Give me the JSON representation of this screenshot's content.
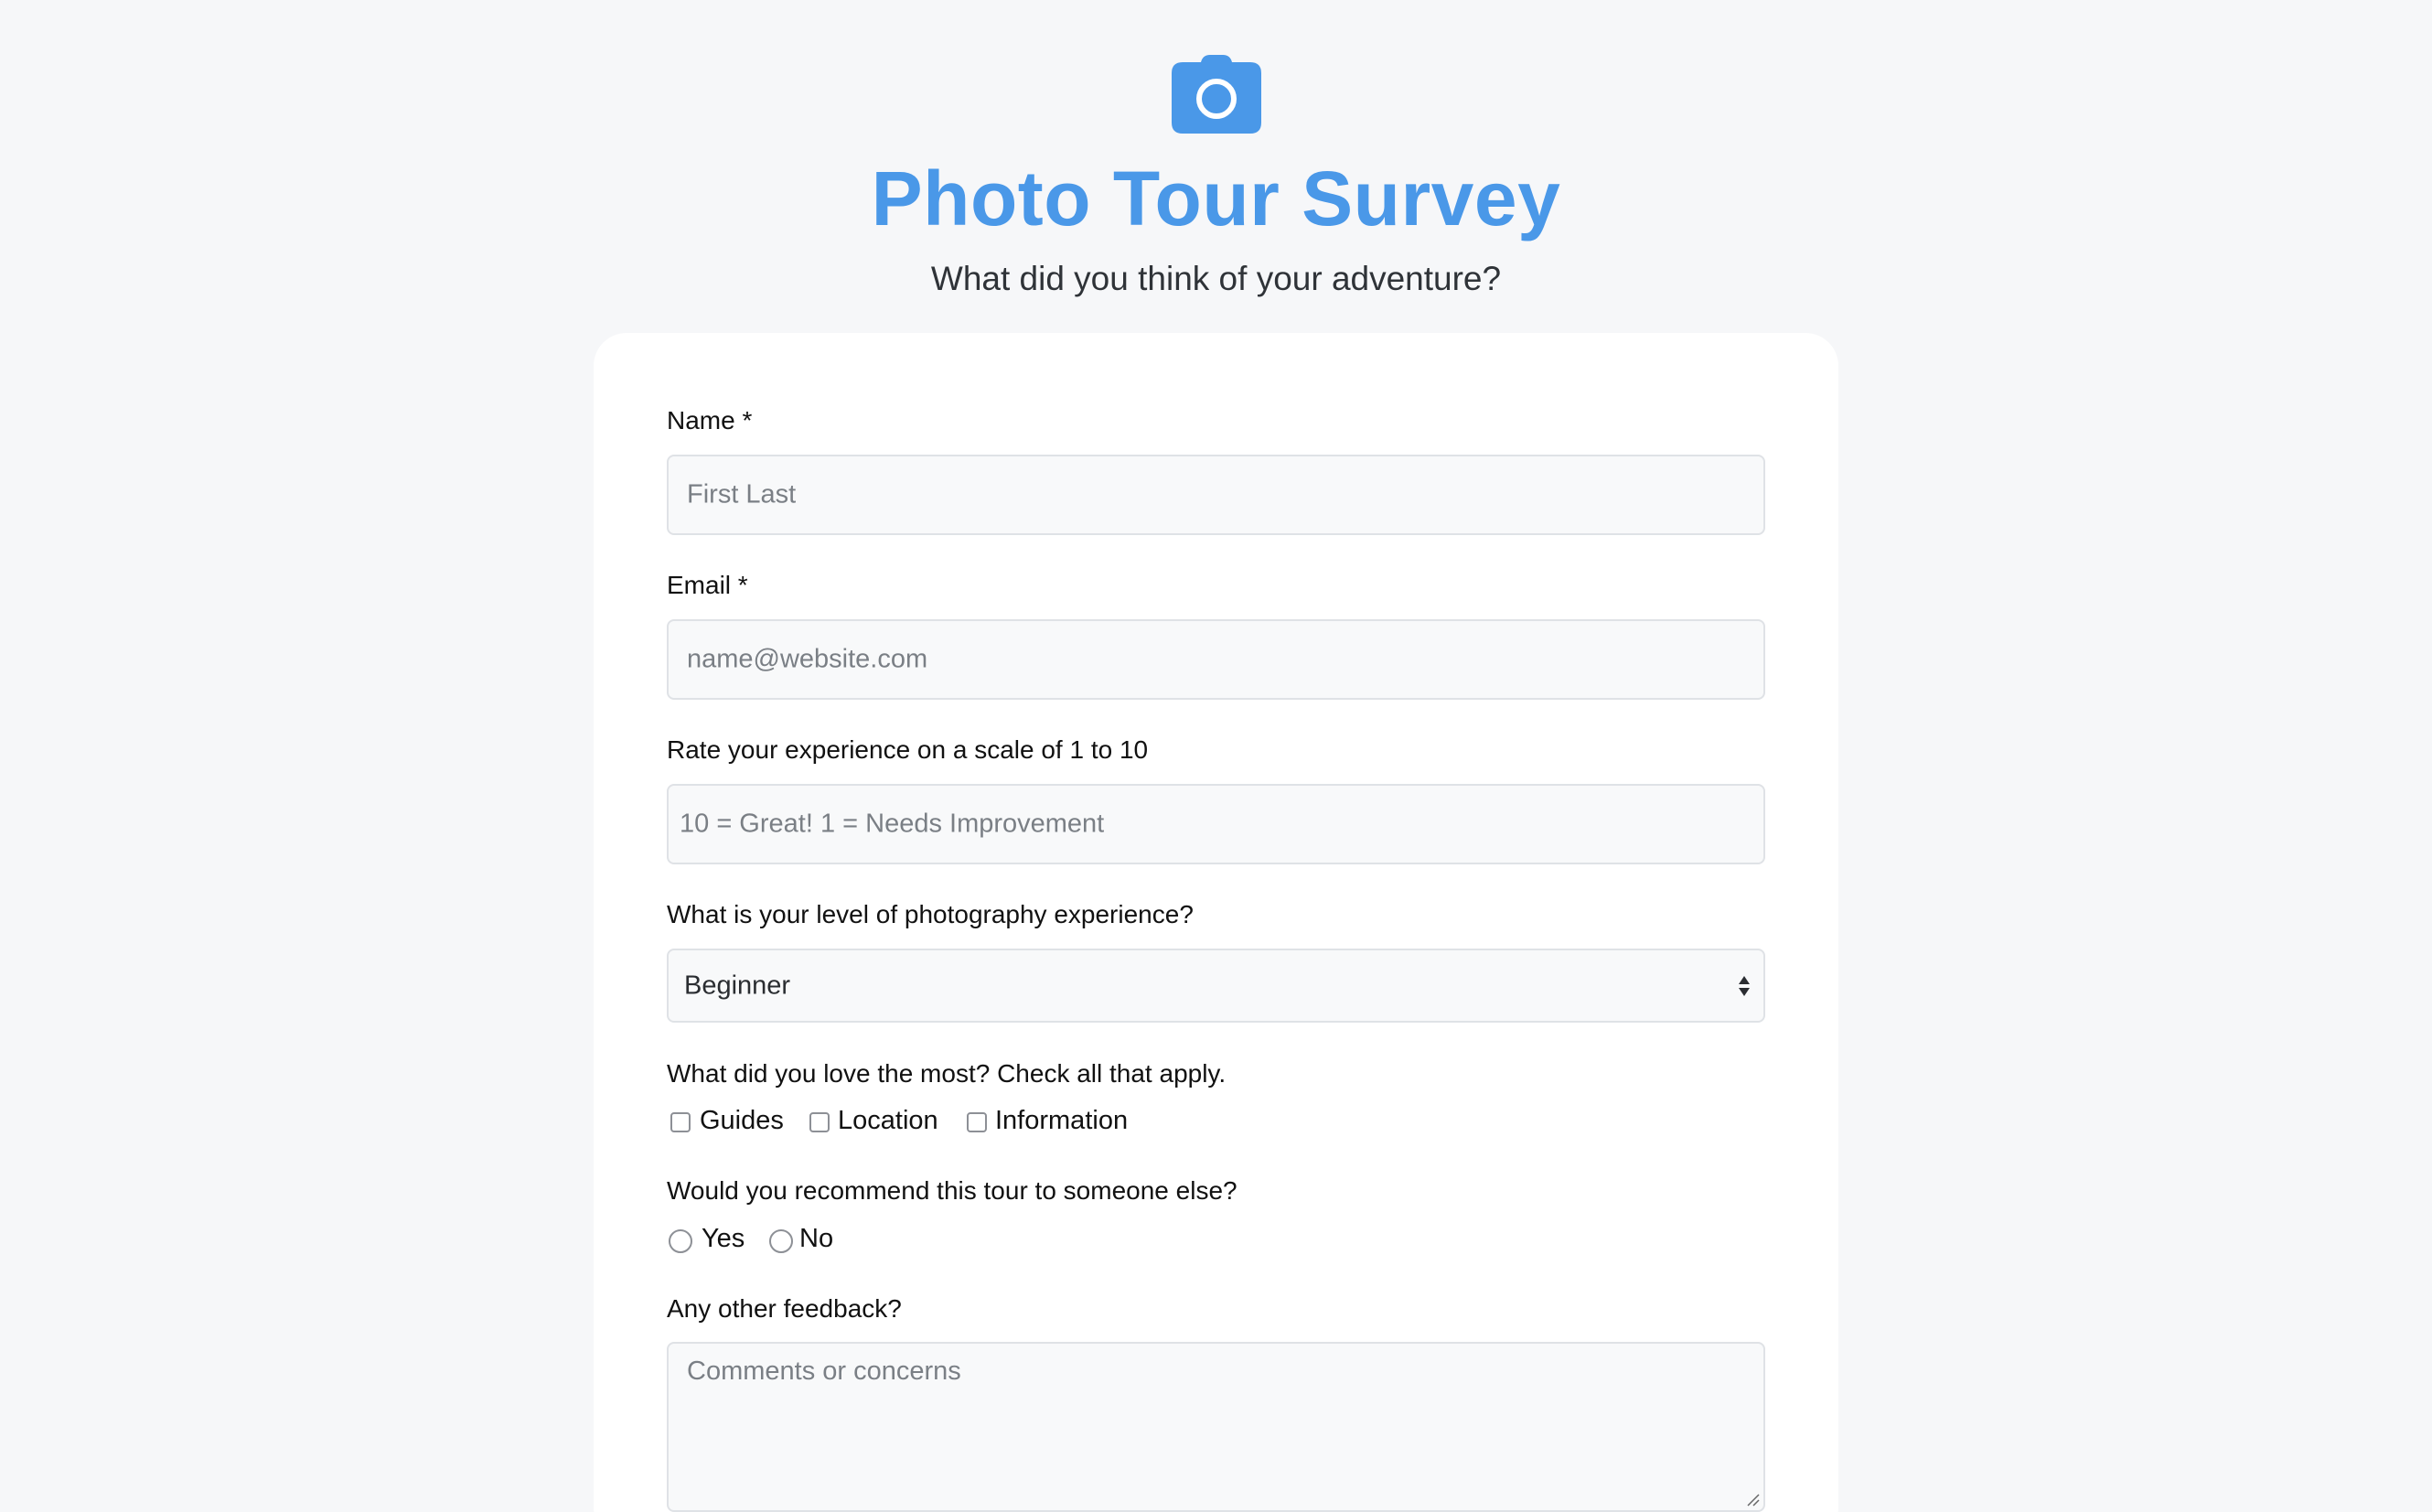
{
  "header": {
    "icon": "camera-icon",
    "title": "Photo Tour Survey",
    "subtitle": "What did you think of your adventure?"
  },
  "form": {
    "name": {
      "label": "Name *",
      "placeholder": "First Last"
    },
    "email": {
      "label": "Email *",
      "placeholder": "name@website.com"
    },
    "rating": {
      "label": "Rate your experience on a scale of 1 to 10",
      "placeholder": "10 = Great! 1 = Needs Improvement"
    },
    "experience": {
      "label": "What is your level of photography experience?",
      "selected": "Beginner"
    },
    "loved": {
      "label": "What did you love the most? Check all that apply.",
      "options": [
        "Guides",
        "Location",
        "Information"
      ]
    },
    "recommend": {
      "label": "Would you recommend this tour to someone else?",
      "options": [
        "Yes",
        "No"
      ]
    },
    "feedback": {
      "label": "Any other feedback?",
      "placeholder": "Comments or concerns"
    }
  },
  "colors": {
    "accent": "#4a98e8",
    "background": "#f6f7f9",
    "card": "#ffffff",
    "field_bg": "#f8f9fa",
    "field_border": "#dfe2e6"
  }
}
